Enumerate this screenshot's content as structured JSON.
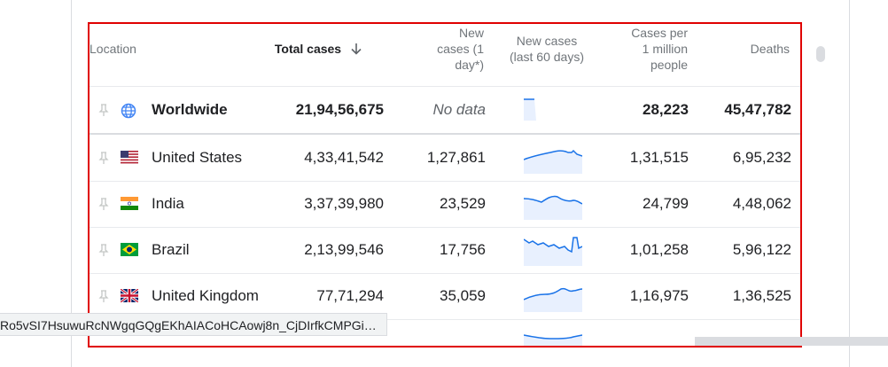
{
  "table": {
    "headers": {
      "location": "Location",
      "total_cases": "Total cases",
      "new_cases": [
        "New",
        "cases (1",
        "day*)"
      ],
      "new_cases_60": [
        "New cases",
        "(last 60 days)"
      ],
      "cases_per_million": [
        "Cases per",
        "1 million",
        "people"
      ],
      "deaths": "Deaths"
    },
    "rows": [
      {
        "location": "Worldwide",
        "total_cases": "21,94,56,675",
        "new_cases": "No data",
        "cases_per_million": "28,223",
        "deaths": "45,47,782",
        "flag": "globe-icon"
      },
      {
        "location": "United States",
        "total_cases": "4,33,41,542",
        "new_cases": "1,27,861",
        "cases_per_million": "1,31,515",
        "deaths": "6,95,232",
        "flag": "us-flag-icon"
      },
      {
        "location": "India",
        "total_cases": "3,37,39,980",
        "new_cases": "23,529",
        "cases_per_million": "24,799",
        "deaths": "4,48,062",
        "flag": "india-flag-icon"
      },
      {
        "location": "Brazil",
        "total_cases": "2,13,99,546",
        "new_cases": "17,756",
        "cases_per_million": "1,01,258",
        "deaths": "5,96,122",
        "flag": "brazil-flag-icon"
      },
      {
        "location": "United Kingdom",
        "total_cases": "77,71,294",
        "new_cases": "35,059",
        "cases_per_million": "1,16,975",
        "deaths": "1,36,525",
        "flag": "uk-flag-icon"
      }
    ]
  },
  "status_bar": {
    "url": "Ro5vSI7HsuwuRcNWgqGQgEKhAIACoHCAowj8n_CjDIrfkCMPGi…"
  },
  "colors": {
    "highlight_border": "#e00000",
    "spark_line": "#1a73e8",
    "spark_fill": "#e8f0fe"
  }
}
